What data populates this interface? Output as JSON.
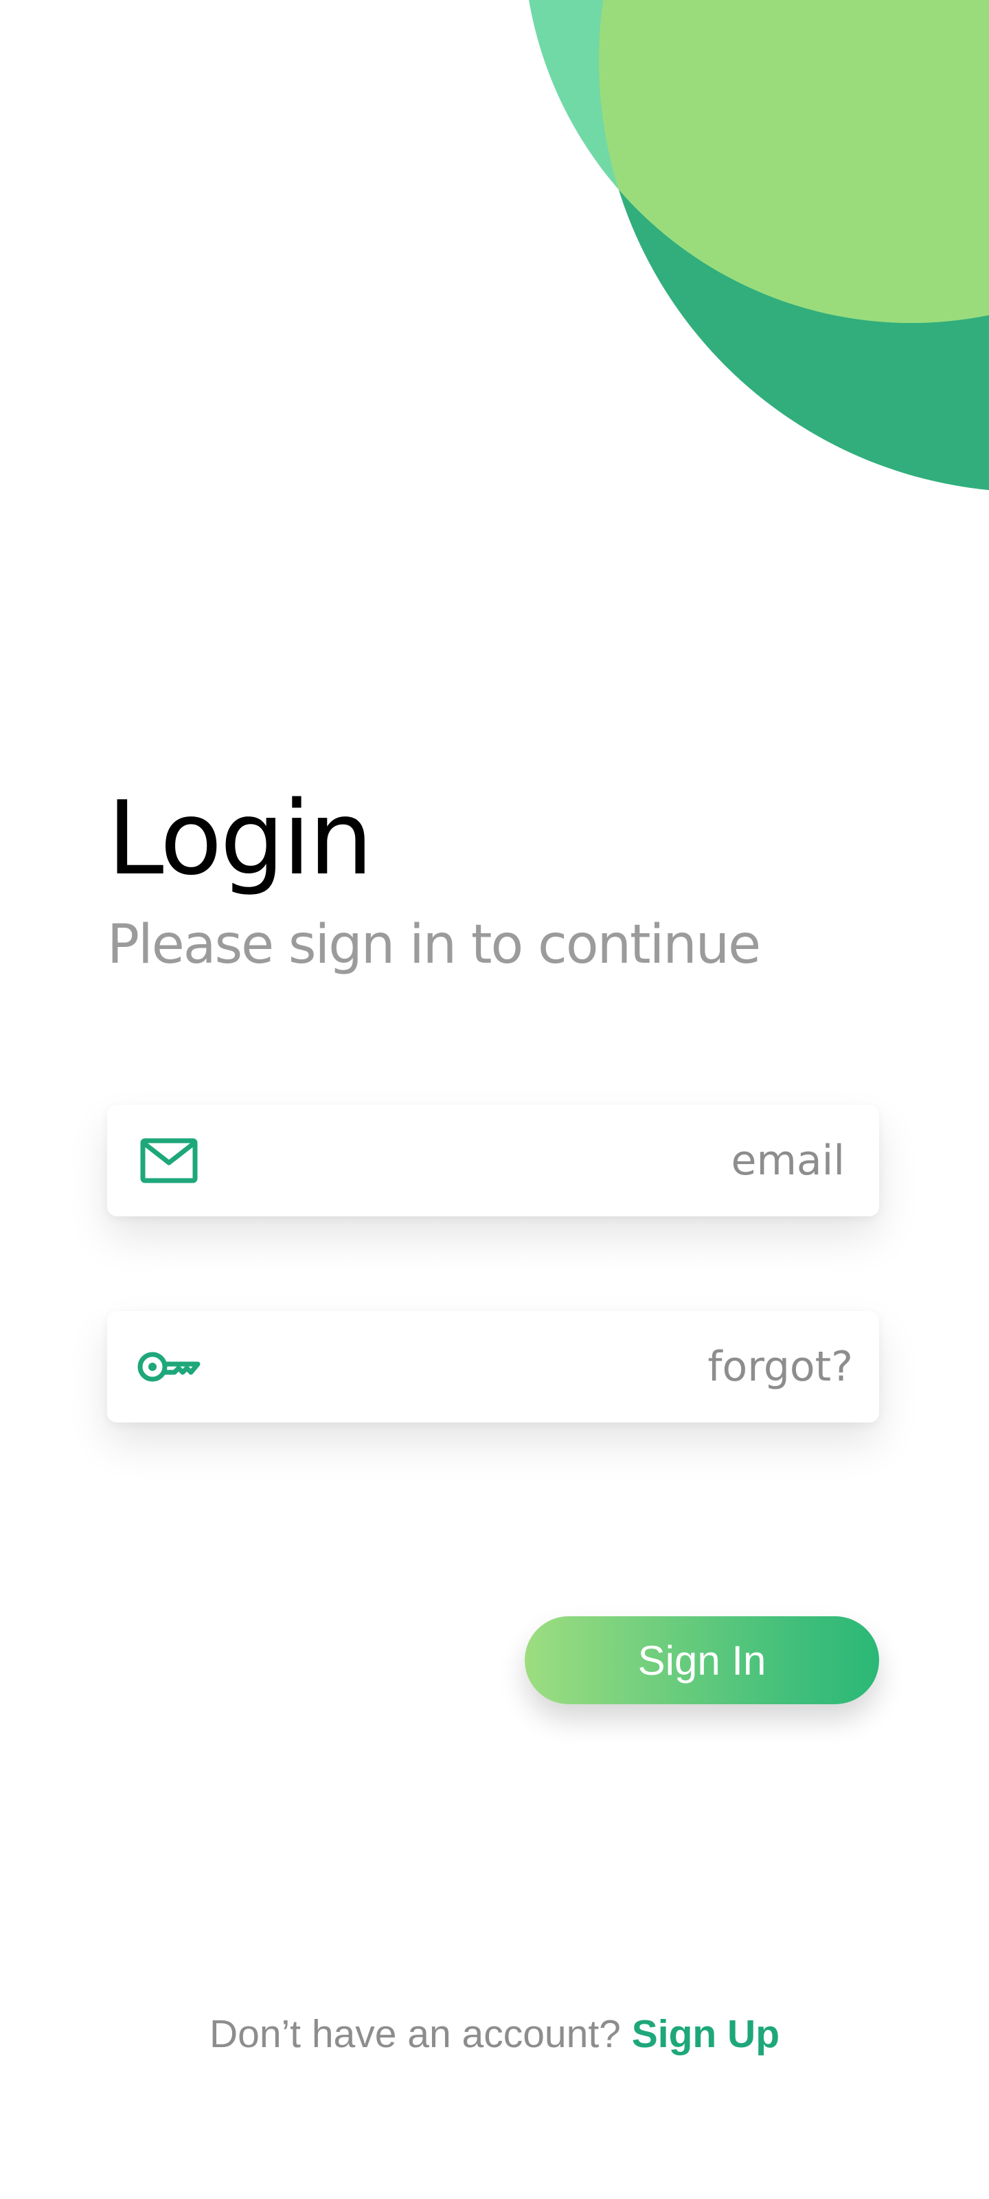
{
  "header": {
    "title": "Login",
    "subtitle": "Please sign in to continue"
  },
  "form": {
    "email": {
      "icon": "mail-icon",
      "placeholder": "email",
      "value": ""
    },
    "password": {
      "icon": "key-icon",
      "placeholder": "",
      "value": "",
      "forgot_label": "forgot?"
    },
    "submit_label": "Sign In"
  },
  "footer": {
    "prompt": "Don’t have an account?",
    "signup_label": "Sign Up"
  },
  "colors": {
    "accent": "#1ea77a",
    "blob_dark": "#31ae7c",
    "blob_light": "#65d69e",
    "gradient_start": "#9ddd80",
    "gradient_end": "#2bb876",
    "muted_text": "#8d8d8d"
  }
}
